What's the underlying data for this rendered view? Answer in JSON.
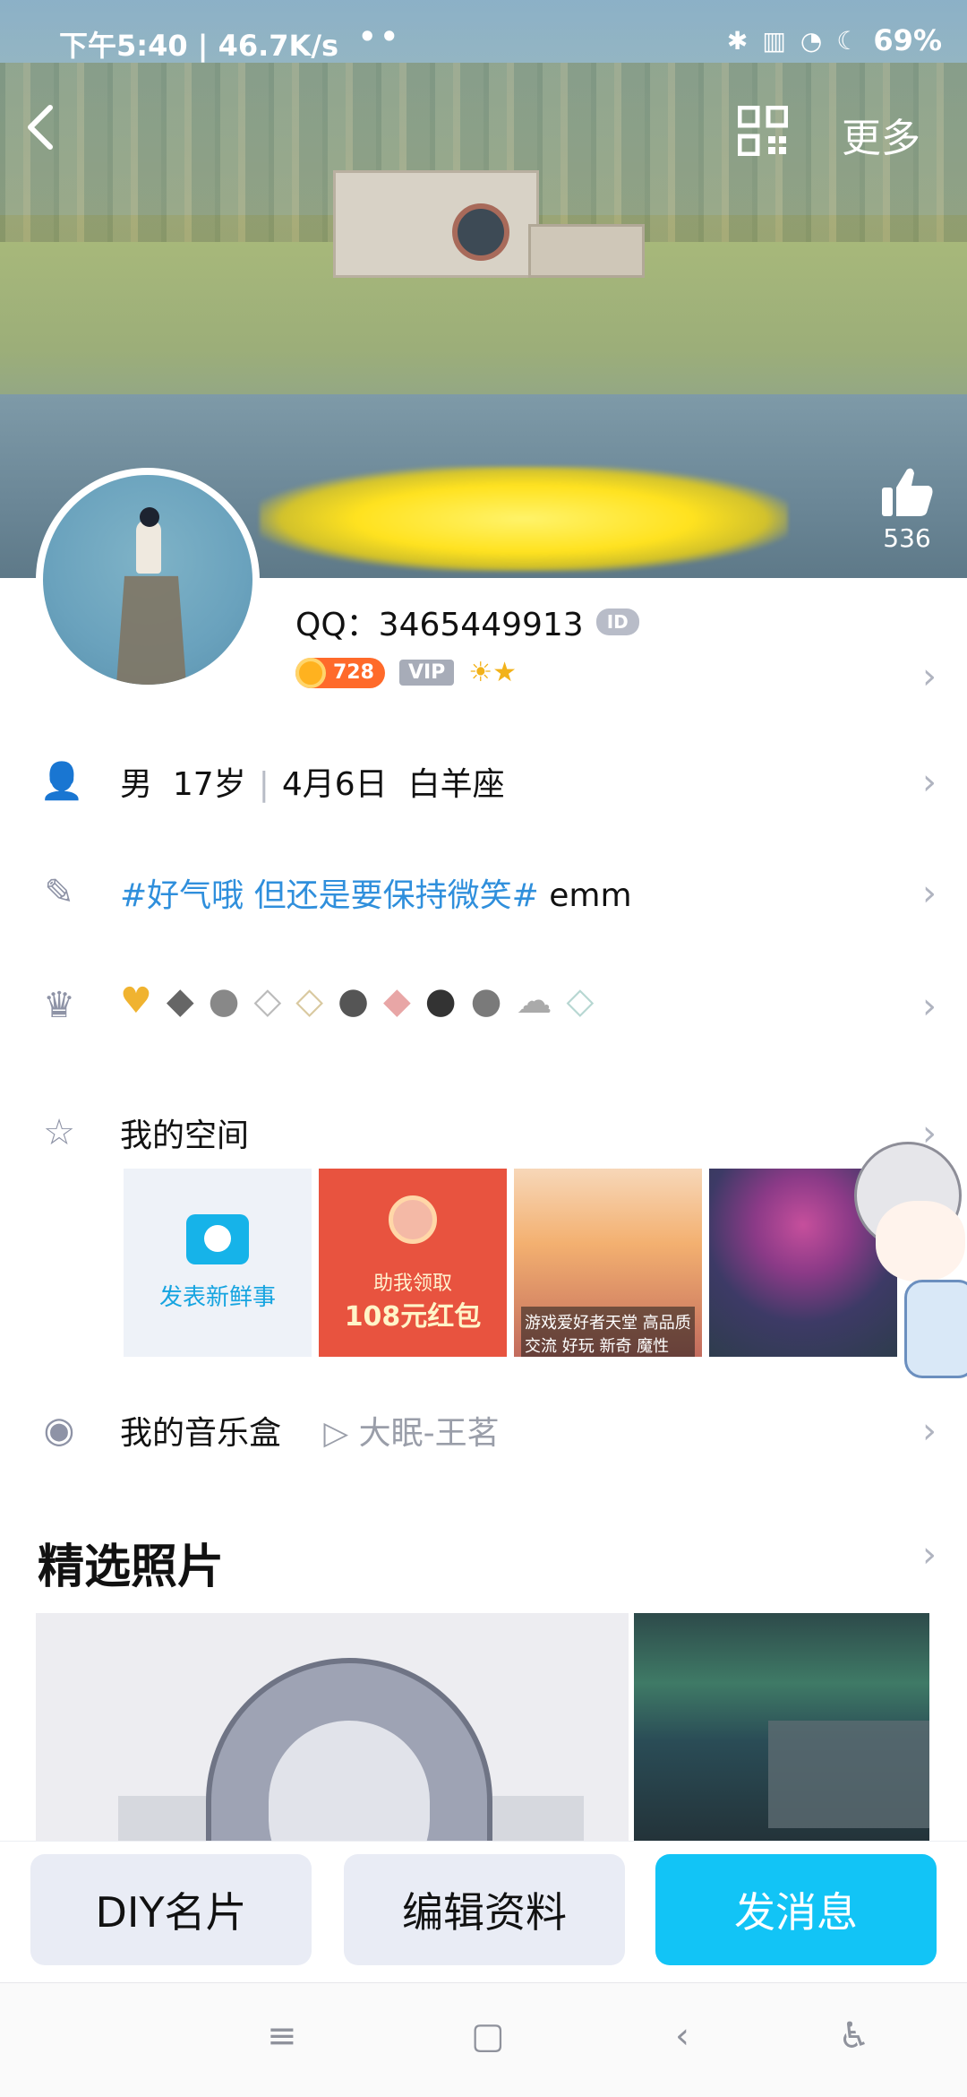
{
  "status_bar": {
    "time_speed": "下午5:40 | 46.7K/s",
    "dots": "••",
    "battery": "69%",
    "icons": [
      "bluetooth-icon",
      "signal-hd-icon",
      "wifi-icon",
      "moon-icon"
    ]
  },
  "nav": {
    "back_icon": "chevron-left-icon",
    "qr_icon": "qr-code-icon",
    "more_label": "更多"
  },
  "profile": {
    "likes": "536",
    "qq_label": "QQ：3465449913",
    "id_badge": "ID",
    "level_value": "728",
    "vip_label": "VIP"
  },
  "rows": {
    "basic": {
      "gender": "男",
      "age": "17岁",
      "birthday": "4月6日",
      "zodiac": "白羊座"
    },
    "signature": {
      "tag": "#好气哦 但还是要保持微笑#",
      "text": " emm"
    },
    "space": {
      "label": "我的空间",
      "post_label": "发表新鲜事",
      "red_line1": "助我领取",
      "red_line2": "108元红包",
      "game_text": "游戏爱好者天堂 高品质交流 好玩 新奇 魔性"
    },
    "music": {
      "label": "我的音乐盒",
      "song": "大眠-王茗"
    }
  },
  "featured": {
    "title": "精选照片"
  },
  "actions": {
    "diy": "DIY名片",
    "edit": "编辑资料",
    "message": "发消息"
  },
  "colors": {
    "accent": "#12c4f6",
    "link": "#2f8fdc",
    "button_bg": "#e9ecf5"
  }
}
